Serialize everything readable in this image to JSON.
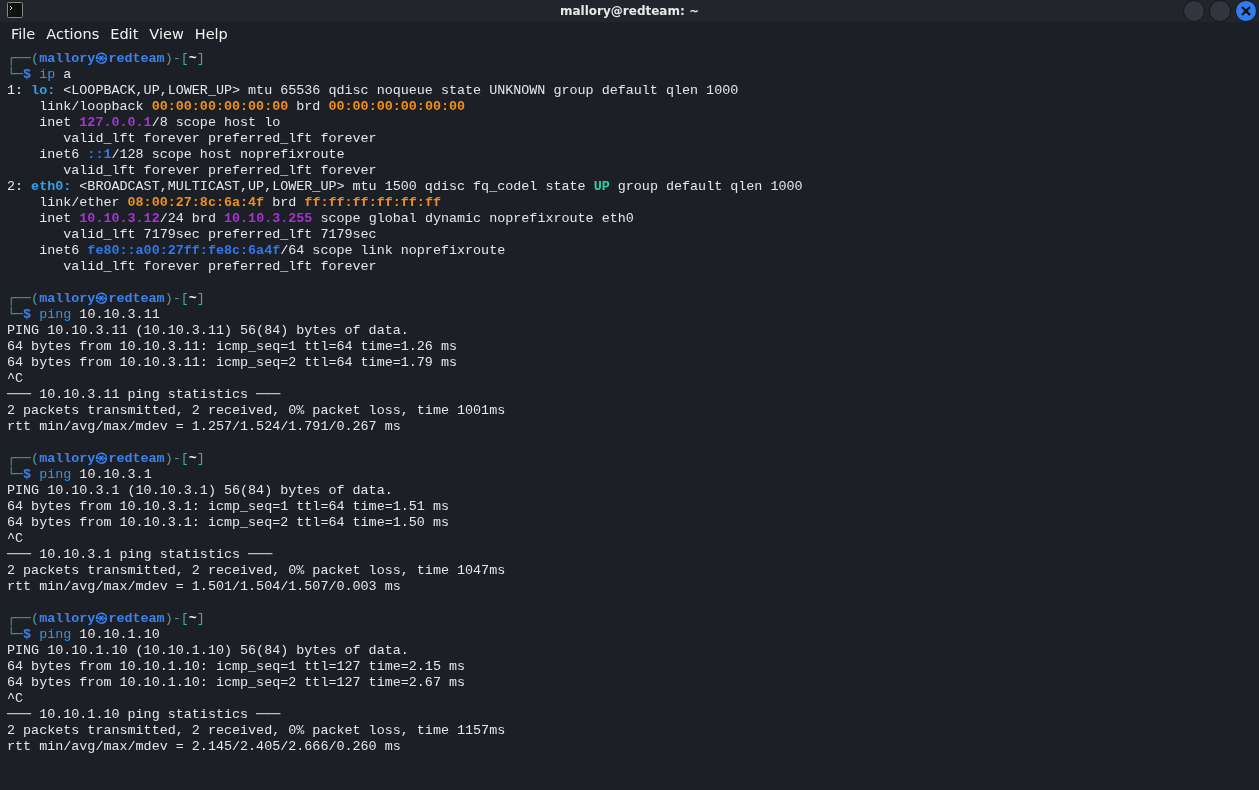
{
  "window": {
    "title": "mallory@redteam: ~"
  },
  "menu": [
    "File",
    "Actions",
    "Edit",
    "View",
    "Help"
  ],
  "blocks": [
    {
      "lines": [
        [
          {
            "t": "┌──(",
            "kind": "frame"
          },
          {
            "t": "mallory㉿redteam",
            "kind": "user"
          },
          {
            "t": ")-[",
            "kind": "frame"
          },
          {
            "t": "~",
            "kind": "dir"
          },
          {
            "t": "]",
            "kind": "frame"
          }
        ],
        [
          {
            "t": "└─",
            "kind": "frame"
          },
          {
            "t": "$",
            "kind": "user"
          },
          {
            "t": " ip",
            "kind": "cmd"
          },
          {
            "t": " a",
            "kind": "plain"
          }
        ],
        [
          {
            "t": "1: ",
            "kind": "plain"
          },
          {
            "t": "lo:",
            "kind": "iface"
          },
          {
            "t": " <LOOPBACK,UP,LOWER_UP> mtu 65536 qdisc noqueue state UNKNOWN group default qlen 1000",
            "kind": "plain"
          }
        ],
        [
          {
            "t": "    link/loopback ",
            "kind": "plain"
          },
          {
            "t": "00:00:00:00:00:00",
            "kind": "mac"
          },
          {
            "t": " brd ",
            "kind": "plain"
          },
          {
            "t": "00:00:00:00:00:00",
            "kind": "mac"
          }
        ],
        [
          {
            "t": "    inet ",
            "kind": "plain"
          },
          {
            "t": "127.0.0.1",
            "kind": "ipv4"
          },
          {
            "t": "/8 scope host lo",
            "kind": "plain"
          }
        ],
        [
          {
            "t": "       valid_lft forever preferred_lft forever",
            "kind": "plain"
          }
        ],
        [
          {
            "t": "    inet6 ",
            "kind": "plain"
          },
          {
            "t": "::1",
            "kind": "ipv6"
          },
          {
            "t": "/128 scope host noprefixroute",
            "kind": "plain"
          }
        ],
        [
          {
            "t": "       valid_lft forever preferred_lft forever",
            "kind": "plain"
          }
        ],
        [
          {
            "t": "2: ",
            "kind": "plain"
          },
          {
            "t": "eth0:",
            "kind": "iface"
          },
          {
            "t": " <BROADCAST,MULTICAST,UP,LOWER_UP> mtu 1500 qdisc fq_codel state ",
            "kind": "plain"
          },
          {
            "t": "UP",
            "kind": "state"
          },
          {
            "t": " group default qlen 1000",
            "kind": "plain"
          }
        ],
        [
          {
            "t": "    link/ether ",
            "kind": "plain"
          },
          {
            "t": "08:00:27:8c:6a:4f",
            "kind": "mac"
          },
          {
            "t": " brd ",
            "kind": "plain"
          },
          {
            "t": "ff:ff:ff:ff:ff:ff",
            "kind": "mac"
          }
        ],
        [
          {
            "t": "    inet ",
            "kind": "plain"
          },
          {
            "t": "10.10.3.12",
            "kind": "ipv4"
          },
          {
            "t": "/24 brd ",
            "kind": "plain"
          },
          {
            "t": "10.10.3.255",
            "kind": "ipv4"
          },
          {
            "t": " scope global dynamic noprefixroute eth0",
            "kind": "plain"
          }
        ],
        [
          {
            "t": "       valid_lft 7179sec preferred_lft 7179sec",
            "kind": "plain"
          }
        ],
        [
          {
            "t": "    inet6 ",
            "kind": "plain"
          },
          {
            "t": "fe80::a00:27ff:fe8c:6a4f",
            "kind": "ipv6"
          },
          {
            "t": "/64 scope link noprefixroute",
            "kind": "plain"
          }
        ],
        [
          {
            "t": "       valid_lft forever preferred_lft forever",
            "kind": "plain"
          }
        ]
      ]
    },
    {
      "lines": [
        [
          {
            "t": "┌──(",
            "kind": "frame"
          },
          {
            "t": "mallory㉿redteam",
            "kind": "user"
          },
          {
            "t": ")-[",
            "kind": "frame"
          },
          {
            "t": "~",
            "kind": "dir"
          },
          {
            "t": "]",
            "kind": "frame"
          }
        ],
        [
          {
            "t": "└─",
            "kind": "frame"
          },
          {
            "t": "$",
            "kind": "user"
          },
          {
            "t": " ping",
            "kind": "cmd"
          },
          {
            "t": " 10.10.3.11",
            "kind": "plain"
          }
        ],
        [
          {
            "t": "PING 10.10.3.11 (10.10.3.11) 56(84) bytes of data.",
            "kind": "plain"
          }
        ],
        [
          {
            "t": "64 bytes from 10.10.3.11: icmp_seq=1 ttl=64 time=1.26 ms",
            "kind": "plain"
          }
        ],
        [
          {
            "t": "64 bytes from 10.10.3.11: icmp_seq=2 ttl=64 time=1.79 ms",
            "kind": "plain"
          }
        ],
        [
          {
            "t": "^C",
            "kind": "plain"
          }
        ],
        [
          {
            "t": "─── 10.10.3.11 ping statistics ───",
            "kind": "plain"
          }
        ],
        [
          {
            "t": "2 packets transmitted, 2 received, 0% packet loss, time 1001ms",
            "kind": "plain"
          }
        ],
        [
          {
            "t": "rtt min/avg/max/mdev = 1.257/1.524/1.791/0.267 ms",
            "kind": "plain"
          }
        ]
      ]
    },
    {
      "lines": [
        [
          {
            "t": "┌──(",
            "kind": "frame"
          },
          {
            "t": "mallory㉿redteam",
            "kind": "user"
          },
          {
            "t": ")-[",
            "kind": "frame"
          },
          {
            "t": "~",
            "kind": "dir"
          },
          {
            "t": "]",
            "kind": "frame"
          }
        ],
        [
          {
            "t": "└─",
            "kind": "frame"
          },
          {
            "t": "$",
            "kind": "user"
          },
          {
            "t": " ping",
            "kind": "cmd"
          },
          {
            "t": " 10.10.3.1",
            "kind": "plain"
          }
        ],
        [
          {
            "t": "PING 10.10.3.1 (10.10.3.1) 56(84) bytes of data.",
            "kind": "plain"
          }
        ],
        [
          {
            "t": "64 bytes from 10.10.3.1: icmp_seq=1 ttl=64 time=1.51 ms",
            "kind": "plain"
          }
        ],
        [
          {
            "t": "64 bytes from 10.10.3.1: icmp_seq=2 ttl=64 time=1.50 ms",
            "kind": "plain"
          }
        ],
        [
          {
            "t": "^C",
            "kind": "plain"
          }
        ],
        [
          {
            "t": "─── 10.10.3.1 ping statistics ───",
            "kind": "plain"
          }
        ],
        [
          {
            "t": "2 packets transmitted, 2 received, 0% packet loss, time 1047ms",
            "kind": "plain"
          }
        ],
        [
          {
            "t": "rtt min/avg/max/mdev = 1.501/1.504/1.507/0.003 ms",
            "kind": "plain"
          }
        ]
      ]
    },
    {
      "lines": [
        [
          {
            "t": "┌──(",
            "kind": "frame"
          },
          {
            "t": "mallory㉿redteam",
            "kind": "user"
          },
          {
            "t": ")-[",
            "kind": "frame"
          },
          {
            "t": "~",
            "kind": "dir"
          },
          {
            "t": "]",
            "kind": "frame"
          }
        ],
        [
          {
            "t": "└─",
            "kind": "frame"
          },
          {
            "t": "$",
            "kind": "user"
          },
          {
            "t": " ping",
            "kind": "cmd"
          },
          {
            "t": " 10.10.1.10",
            "kind": "plain"
          }
        ],
        [
          {
            "t": "PING 10.10.1.10 (10.10.1.10) 56(84) bytes of data.",
            "kind": "plain"
          }
        ],
        [
          {
            "t": "64 bytes from 10.10.1.10: icmp_seq=1 ttl=127 time=2.15 ms",
            "kind": "plain"
          }
        ],
        [
          {
            "t": "64 bytes from 10.10.1.10: icmp_seq=2 ttl=127 time=2.67 ms",
            "kind": "plain"
          }
        ],
        [
          {
            "t": "^C",
            "kind": "plain"
          }
        ],
        [
          {
            "t": "─── 10.10.1.10 ping statistics ───",
            "kind": "plain"
          }
        ],
        [
          {
            "t": "2 packets transmitted, 2 received, 0% packet loss, time 1157ms",
            "kind": "plain"
          }
        ],
        [
          {
            "t": "rtt min/avg/max/mdev = 2.145/2.405/2.666/0.260 ms",
            "kind": "plain"
          }
        ]
      ]
    }
  ]
}
